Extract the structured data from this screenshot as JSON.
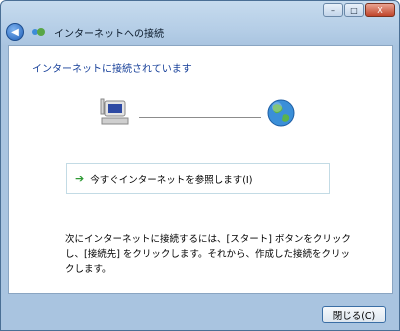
{
  "window": {
    "title": "インターネットへの接続",
    "controls": {
      "minimize": "–",
      "maximize": "□",
      "close": "X"
    }
  },
  "content": {
    "heading": "インターネットに接続されています",
    "link_label": "今すぐインターネットを参照します(I)",
    "info_text": "次にインターネットに接続するには、[スタート] ボタンをクリックし、[接続先] をクリックします。それから、作成した接続をクリックします。"
  },
  "footer": {
    "close_label": "閉じる(C)"
  },
  "colors": {
    "accent": "#163f99",
    "link_arrow": "#2f9a35",
    "frame": "#a9c4e0"
  },
  "icons": [
    "back-icon",
    "network-connection-icon",
    "computer-icon",
    "globe-icon",
    "arrow-right-icon"
  ]
}
